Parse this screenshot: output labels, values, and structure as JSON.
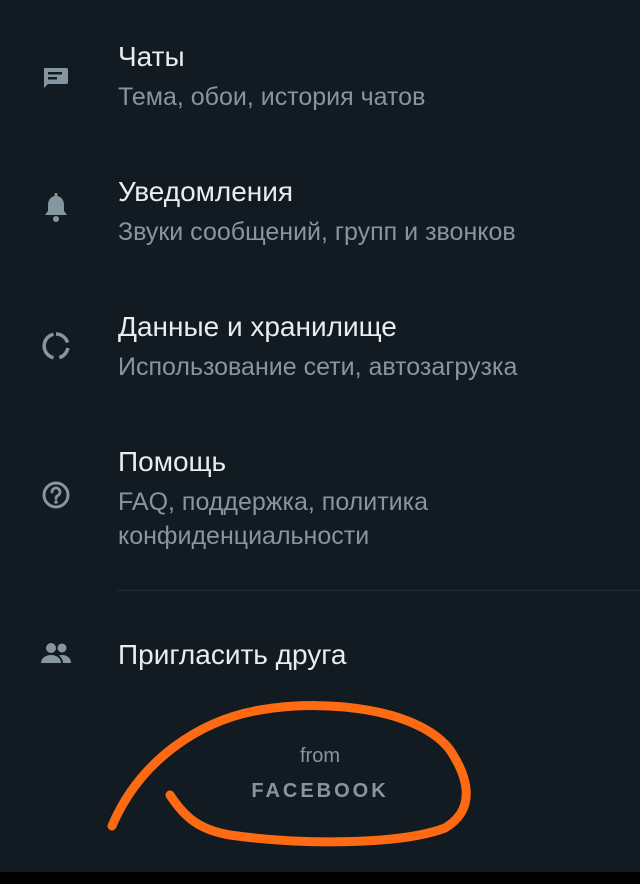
{
  "menu": {
    "items": [
      {
        "id": "chats",
        "icon": "chat-icon",
        "title": "Чаты",
        "subtitle": "Тема, обои, история чатов"
      },
      {
        "id": "notifications",
        "icon": "bell-icon",
        "title": "Уведомления",
        "subtitle": "Звуки сообщений, групп и звонков"
      },
      {
        "id": "storage",
        "icon": "data-circle-icon",
        "title": "Данные и хранилище",
        "subtitle": "Использование сети, автозагрузка"
      },
      {
        "id": "help",
        "icon": "help-icon",
        "title": "Помощь",
        "subtitle": "FAQ, поддержка, политика конфиденциальности"
      },
      {
        "id": "invite",
        "icon": "people-icon",
        "title": "Пригласить друга"
      }
    ]
  },
  "footer": {
    "from": "from",
    "brand": "FACEBOOK"
  },
  "colors": {
    "background": "#111b21",
    "title": "#e9edef",
    "subtitle": "#8696a0",
    "icon": "#8696a0",
    "annotation": "#ff6a13"
  }
}
